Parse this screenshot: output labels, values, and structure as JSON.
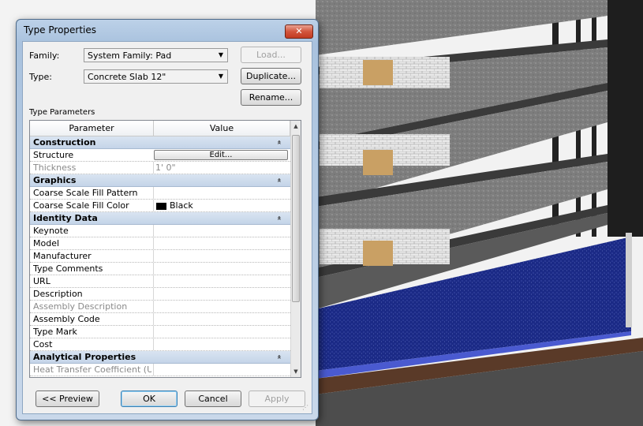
{
  "dialog": {
    "title": "Type Properties",
    "close_label": "✕",
    "family_label": "Family:",
    "family_value": "System Family: Pad",
    "type_label": "Type:",
    "type_value": "Concrete Slab 12\"",
    "load_label": "Load...",
    "duplicate_label": "Duplicate...",
    "rename_label": "Rename...",
    "type_parameters_label": "Type Parameters",
    "grid": {
      "header_parameter": "Parameter",
      "header_value": "Value"
    },
    "rows": [
      {
        "kind": "group",
        "label": "Construction"
      },
      {
        "kind": "button",
        "label": "Structure",
        "value": "Edit..."
      },
      {
        "kind": "dim",
        "label": "Thickness",
        "value": "1'  0\""
      },
      {
        "kind": "group",
        "label": "Graphics"
      },
      {
        "kind": "plain",
        "label": "Coarse Scale Fill Pattern",
        "value": ""
      },
      {
        "kind": "color",
        "label": "Coarse Scale Fill Color",
        "value": "Black"
      },
      {
        "kind": "group",
        "label": "Identity Data"
      },
      {
        "kind": "plain",
        "label": "Keynote",
        "value": ""
      },
      {
        "kind": "plain",
        "label": "Model",
        "value": ""
      },
      {
        "kind": "plain",
        "label": "Manufacturer",
        "value": ""
      },
      {
        "kind": "plain",
        "label": "Type Comments",
        "value": ""
      },
      {
        "kind": "plain",
        "label": "URL",
        "value": ""
      },
      {
        "kind": "plain",
        "label": "Description",
        "value": ""
      },
      {
        "kind": "dim",
        "label": "Assembly Description",
        "value": ""
      },
      {
        "kind": "plain",
        "label": "Assembly Code",
        "value": ""
      },
      {
        "kind": "plain",
        "label": "Type Mark",
        "value": ""
      },
      {
        "kind": "plain",
        "label": "Cost",
        "value": ""
      },
      {
        "kind": "group",
        "label": "Analytical Properties"
      },
      {
        "kind": "dim",
        "label": "Heat Transfer Coefficient (U)",
        "value": ""
      }
    ],
    "preview_label": "<< Preview",
    "ok_label": "OK",
    "cancel_label": "Cancel",
    "apply_label": "Apply"
  },
  "colors": {
    "group_header": "#c4d4e8",
    "floor_blue": "#2d3f9e",
    "close_red": "#c23b21"
  }
}
